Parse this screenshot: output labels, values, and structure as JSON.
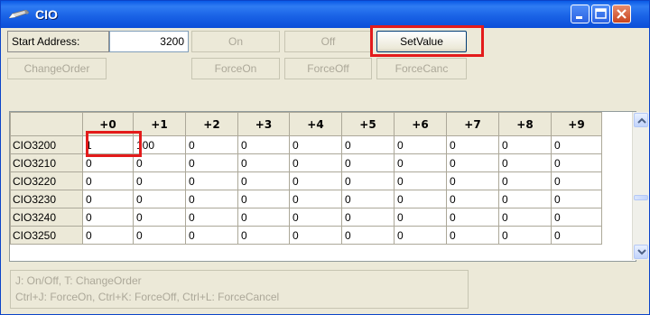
{
  "window": {
    "title": "CIO",
    "controls": [
      "minimize",
      "maximize",
      "close"
    ]
  },
  "toolbar": {
    "start_address_label": "Start Address:",
    "start_address_value": "3200",
    "buttons_row1": [
      {
        "label": "On",
        "enabled": false
      },
      {
        "label": "Off",
        "enabled": false
      },
      {
        "label": "SetValue",
        "enabled": true
      }
    ],
    "buttons_row2": [
      {
        "label": "ChangeOrder",
        "enabled": false
      },
      {
        "label": "ForceOn",
        "enabled": false
      },
      {
        "label": "ForceOff",
        "enabled": false
      },
      {
        "label": "ForceCanc",
        "enabled": false
      }
    ]
  },
  "grid": {
    "columns": [
      "+0",
      "+1",
      "+2",
      "+3",
      "+4",
      "+5",
      "+6",
      "+7",
      "+8",
      "+9"
    ],
    "rows": [
      {
        "label": "CIO3200",
        "values": [
          "1",
          "100",
          "0",
          "0",
          "0",
          "0",
          "0",
          "0",
          "0",
          "0"
        ]
      },
      {
        "label": "CIO3210",
        "values": [
          "0",
          "0",
          "0",
          "0",
          "0",
          "0",
          "0",
          "0",
          "0",
          "0"
        ]
      },
      {
        "label": "CIO3220",
        "values": [
          "0",
          "0",
          "0",
          "0",
          "0",
          "0",
          "0",
          "0",
          "0",
          "0"
        ]
      },
      {
        "label": "CIO3230",
        "values": [
          "0",
          "0",
          "0",
          "0",
          "0",
          "0",
          "0",
          "0",
          "0",
          "0"
        ]
      },
      {
        "label": "CIO3240",
        "values": [
          "0",
          "0",
          "0",
          "0",
          "0",
          "0",
          "0",
          "0",
          "0",
          "0"
        ]
      },
      {
        "label": "CIO3250",
        "values": [
          "0",
          "0",
          "0",
          "0",
          "0",
          "0",
          "0",
          "0",
          "0",
          "0"
        ]
      }
    ]
  },
  "status": {
    "line1": "J: On/Off,   T: ChangeOrder",
    "line2": "Ctrl+J: ForceOn,   Ctrl+K: ForceOff,   Ctrl+L: ForceCancel"
  },
  "colors": {
    "title_bar": "#1a63e6",
    "highlight": "#e31b1b",
    "face": "#ece9d8",
    "disabled_text": "#aca899"
  },
  "icons": {
    "window": "pencil-icon",
    "scroll_up": "chevron-up-icon",
    "scroll_down": "chevron-down-icon"
  }
}
